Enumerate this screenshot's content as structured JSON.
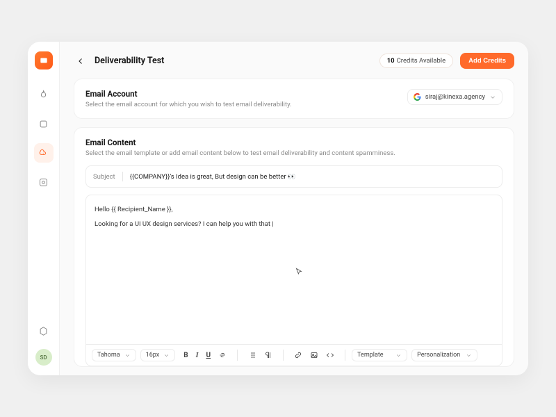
{
  "header": {
    "title": "Deliverability Test",
    "credits_count": "10",
    "credits_label": "Credits Available",
    "add_credits": "Add Credits"
  },
  "account": {
    "title": "Email Account",
    "subtitle": "Select the email account for which you wish to test email deliverability.",
    "selected": "siraj@kinexa.agency"
  },
  "content": {
    "title": "Email Content",
    "subtitle": "Select the email template or add email content below to test email deliverability and content spamminess.",
    "subject_label": "Subject",
    "subject_value": "{{COMPANY}}'s Idea is great, But design can be better 👀",
    "body_line1": "Hello {{ Recipient_Name }},",
    "body_line2": "Looking for a UI UX design services? I can help you with that |"
  },
  "toolbar": {
    "font": "Tahoma",
    "size": "16px",
    "template": "Template",
    "personalization": "Personalization"
  },
  "avatar": "SD"
}
